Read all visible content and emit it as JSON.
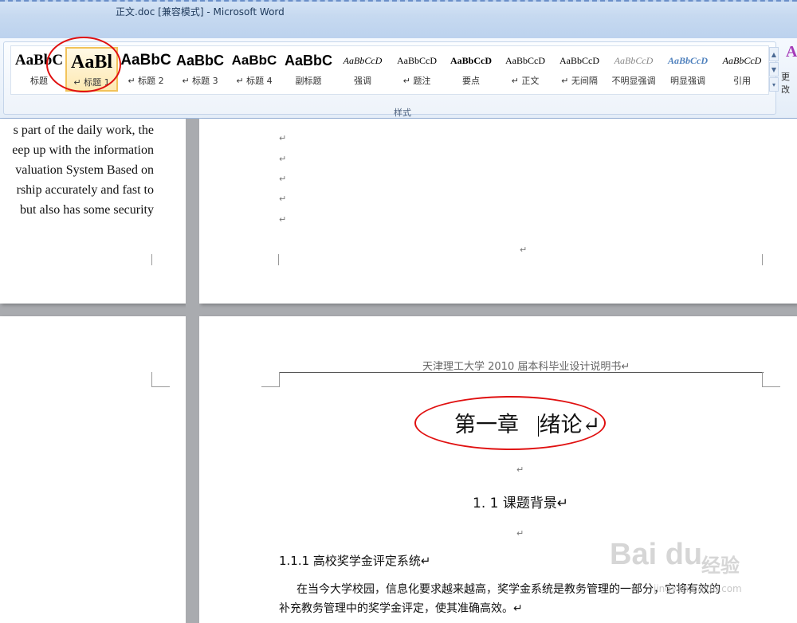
{
  "window": {
    "title": "正文.doc [兼容模式] - Microsoft Word"
  },
  "ribbon": {
    "group_label": "样式",
    "change_styles_label": "更改",
    "styles": [
      {
        "sample": "AaBbC",
        "label": "标题"
      },
      {
        "sample": "AaBl",
        "label": "↵ 标题 1"
      },
      {
        "sample": "AaBbC",
        "label": "↵ 标题 2"
      },
      {
        "sample": "AaBbC",
        "label": "↵ 标题 3"
      },
      {
        "sample": "AaBbC",
        "label": "↵ 标题 4"
      },
      {
        "sample": "AaBbC",
        "label": "副标题"
      },
      {
        "sample": "AaBbCcD",
        "label": "强调"
      },
      {
        "sample": "AaBbCcD",
        "label": "↵ 题注"
      },
      {
        "sample": "AaBbCcD",
        "label": "要点"
      },
      {
        "sample": "AaBbCcD",
        "label": "↵ 正文"
      },
      {
        "sample": "AaBbCcD",
        "label": "↵ 无间隔"
      },
      {
        "sample": "AaBbCcD",
        "label": "不明显强调"
      },
      {
        "sample": "AaBbCcD",
        "label": "明显强调"
      },
      {
        "sample": "AaBbCcD",
        "label": "引用"
      }
    ],
    "selected_style_index": 1
  },
  "document": {
    "left_page_lines": [
      "s part of the daily work, the",
      "eep up with the information",
      "valuation System Based on",
      "rship accurately and fast to",
      "but also has some security"
    ],
    "paragraph_mark": "↵",
    "header_text": "天津理工大学 2010 届本科毕业设计说明书↵",
    "chapter_title_a": "第一章",
    "chapter_title_b": "绪论↵",
    "section_title": "1. 1 课题背景↵",
    "subsection_title": "1.1.1 高校奖学金评定系统↵",
    "body_lines": [
      "在当今大学校园，信息化要求越来越高，奖学金系统是教务管理的一部分，它将有效的",
      "补充教务管理中的奖学金评定，使其准确高效。↵"
    ]
  },
  "watermark": {
    "brand": "Bai du",
    "cn": "经验",
    "sub": "jingyan.baidu.com"
  },
  "colors": {
    "highlight": "#e01010",
    "selected_style_border": "#f2c35a"
  }
}
